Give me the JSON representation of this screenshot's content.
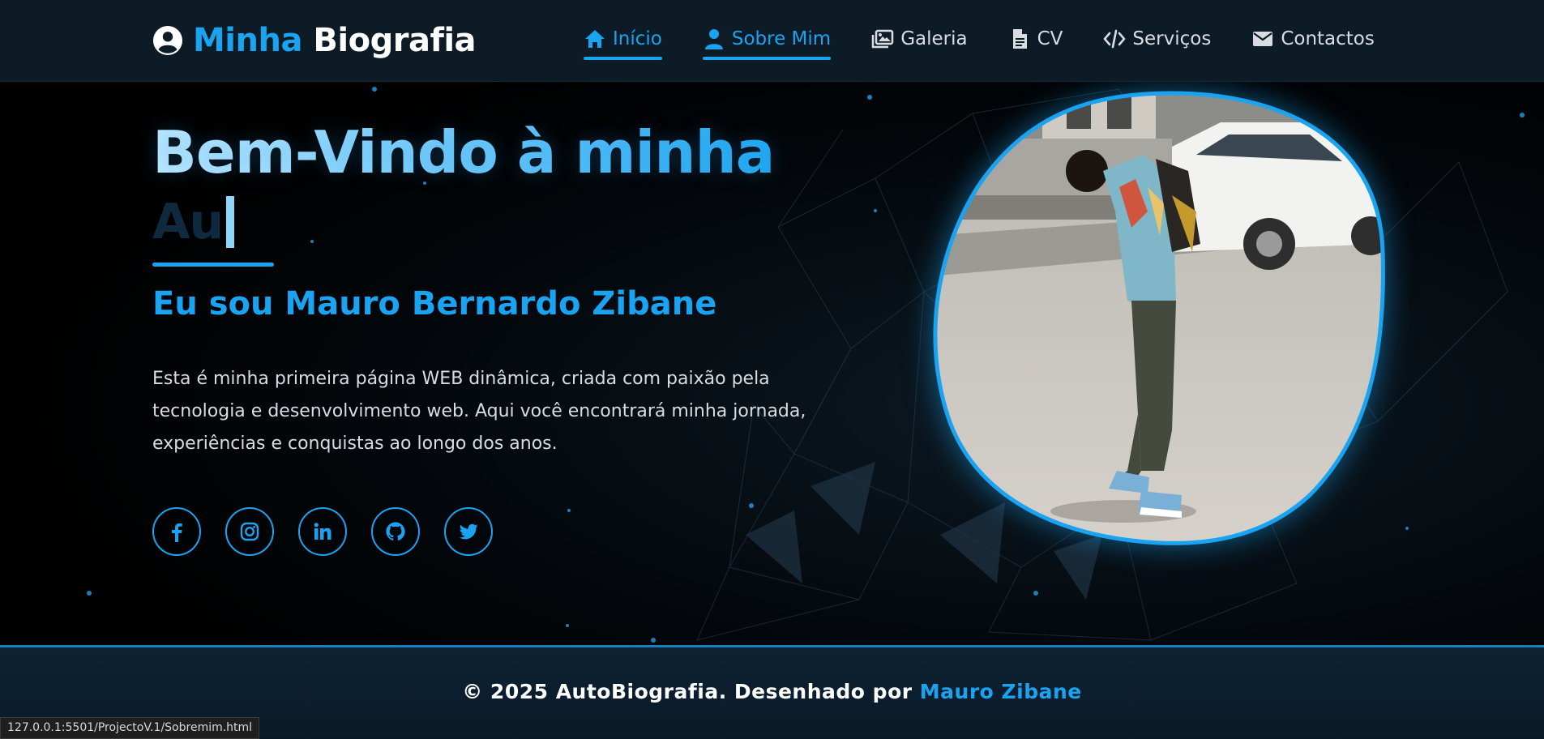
{
  "brand": {
    "first": "Minha",
    "second": "Biografia",
    "icon": "user-circle-icon"
  },
  "nav": [
    {
      "label": "Início",
      "icon": "home-icon",
      "active": true
    },
    {
      "label": "Sobre Mim",
      "icon": "user-icon",
      "active": true
    },
    {
      "label": "Galeria",
      "icon": "images-icon",
      "active": false
    },
    {
      "label": "CV",
      "icon": "file-icon",
      "active": false
    },
    {
      "label": "Serviços",
      "icon": "code-icon",
      "active": false
    },
    {
      "label": "Contactos",
      "icon": "envelope-icon",
      "active": false
    }
  ],
  "hero": {
    "title": "Bem-Vindo à minha",
    "typing": "Au",
    "subtitle": "Eu sou Mauro Bernardo Zibane",
    "intro": "Esta é minha primeira página WEB dinâmica, criada com paixão pela tecnologia e desenvolvimento web. Aqui você encontrará minha jornada, experiências e conquistas ao longo dos anos."
  },
  "socials": [
    {
      "icon": "facebook-icon"
    },
    {
      "icon": "instagram-icon"
    },
    {
      "icon": "linkedin-icon"
    },
    {
      "icon": "github-icon"
    },
    {
      "icon": "twitter-icon"
    }
  ],
  "footer": {
    "prefix": "© 2025 AutoBiografia. Desenhado por",
    "author": "Mauro Zibane"
  },
  "status_url": "127.0.0.1:5501/ProjectoV.1/Sobremim.html",
  "colors": {
    "accent": "#1aa3f0",
    "navbar_bg": "#0d1b27",
    "footer_bg": "#0d2233"
  }
}
